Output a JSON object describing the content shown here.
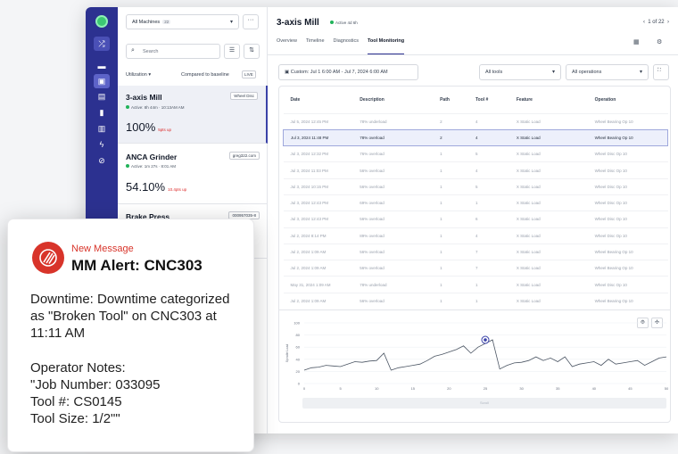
{
  "sidebar": {
    "icons": [
      "shuffle-icon",
      "folder-icon",
      "machine-icon",
      "calendar-icon",
      "document-icon",
      "chart-icon",
      "lightning-icon",
      "link-icon"
    ]
  },
  "list": {
    "machine_select": "All Machines",
    "machine_count": "22",
    "search_placeholder": "Search",
    "utilization_label": "Utilization ▾",
    "baseline_label": "Compared to baseline",
    "live_label": "LIVE",
    "machines": [
      {
        "name": "3-axis Mill",
        "tag": "Wheel Disc",
        "status": "Active: 8h 44m",
        "since": "10:13AM AM",
        "value": "100%",
        "delta": "5pts up"
      },
      {
        "name": "ANCA Grinder",
        "tag": "greg322.com",
        "status": "Active: 1m 27s",
        "since": "8:01 AM",
        "value": "54.10%",
        "delta": "10.4pts up"
      },
      {
        "name": "Brake Press",
        "tag": "000957035-8",
        "status": "",
        "since": "",
        "value": "",
        "delta": ""
      }
    ]
  },
  "detail": {
    "title": "3-axis Mill",
    "status": "Active 4d 6h",
    "pager": "1 of 22",
    "tabs": [
      "Overview",
      "Timeline",
      "Diagnostics",
      "Tool Monitoring"
    ],
    "active_tab": "Tool Monitoring",
    "date_range": "Custom:  Jul 1 6:00 AM - Jul 7, 2024 6:00 AM",
    "tools_filter": "All tools",
    "ops_filter": "All operations",
    "table": {
      "headers": [
        "Date",
        "Description",
        "Path",
        "Tool #",
        "Feature",
        "Operation"
      ],
      "rows": [
        [
          "Jul 5, 2024 12:45 PM",
          "78% underload",
          "2",
          "4",
          "X Static Load",
          "Wheel Bearing Op 10"
        ],
        [
          "Jul 3, 2024 11:48 PM",
          "78% overload",
          "2",
          "4",
          "X Static Load",
          "Wheel Bearing Op 10"
        ],
        [
          "Jul 3, 2024 12:32 PM",
          "76% overload",
          "1",
          "5",
          "X Static Load",
          "Wheel Disc Op 10"
        ],
        [
          "Jul 3, 2024 11:03 PM",
          "56% overload",
          "1",
          "4",
          "X Static Load",
          "Wheel Disc Op 10"
        ],
        [
          "Jul 3, 2024 10:15 PM",
          "56% overload",
          "1",
          "5",
          "X Static Load",
          "Wheel Disc Op 10"
        ],
        [
          "Jul 3, 2024 12:43 PM",
          "69% overload",
          "1",
          "1",
          "X Static Load",
          "Wheel Disc Op 10"
        ],
        [
          "Jul 3, 2024 12:43 PM",
          "56% overload",
          "1",
          "6",
          "X Static Load",
          "Wheel Disc Op 10"
        ],
        [
          "Jul 2, 2024 8:14 PM",
          "89% overload",
          "1",
          "4",
          "X Static Load",
          "Wheel Disc Op 10"
        ],
        [
          "Jul 2, 2024 1:09 AM",
          "56% overload",
          "1",
          "7",
          "X Static Load",
          "Wheel Bearing Op 10"
        ],
        [
          "Jul 2, 2024 1:09 AM",
          "56% overload",
          "1",
          "7",
          "X Static Load",
          "Wheel Bearing Op 10"
        ],
        [
          "May 31, 2024 1:09 AM",
          "78% underload",
          "1",
          "1",
          "X Static Load",
          "Wheel Disc Op 10"
        ],
        [
          "Jul 2, 2024 1:09 AM",
          "56% overload",
          "1",
          "1",
          "X Static Load",
          "Wheel Bearing Op 10"
        ]
      ],
      "selected_row": 1
    },
    "scroll_label": "Scroll"
  },
  "chart_data": {
    "type": "line",
    "title": "",
    "xlabel": "",
    "ylabel": "Spindle Load",
    "x_ticks": [
      "0",
      "5",
      "10",
      "15",
      "20",
      "25",
      "30",
      "35",
      "40",
      "45",
      "50"
    ],
    "y_ticks": [
      "0",
      "20",
      "40",
      "60",
      "80",
      "100"
    ],
    "xlim": [
      0,
      50
    ],
    "ylim": [
      0,
      100
    ],
    "series": [
      {
        "x": [
          0,
          1,
          2,
          3,
          4,
          5,
          6,
          7,
          8,
          9,
          10,
          11,
          12,
          13,
          14,
          15,
          16,
          17,
          18,
          19,
          20,
          21,
          22,
          23,
          24,
          25,
          26,
          27,
          28,
          29,
          30,
          31,
          32,
          33,
          34,
          35,
          36,
          37,
          38,
          39,
          40,
          41,
          42,
          43,
          44,
          45,
          46,
          47,
          48,
          49,
          50
        ],
        "values": [
          22,
          26,
          27,
          30,
          29,
          28,
          32,
          36,
          35,
          37,
          38,
          50,
          22,
          26,
          28,
          30,
          32,
          38,
          45,
          48,
          52,
          56,
          62,
          50,
          60,
          66,
          72,
          24,
          30,
          34,
          35,
          38,
          44,
          38,
          42,
          36,
          44,
          28,
          32,
          34,
          36,
          30,
          40,
          32,
          34,
          36,
          38,
          30,
          36,
          42,
          44
        ]
      }
    ],
    "marker": {
      "x": 25,
      "value": 72
    },
    "grid": true
  },
  "notification": {
    "kicker": "New Message",
    "title": "MM Alert: CNC303",
    "body": "Downtime: Downtime categorized as \"Broken Tool\" on CNC303 at 11:11 AM",
    "notes": [
      "Operator Notes:",
      "\"Job Number: 033095",
      "Tool #: CS0145",
      "Tool Size: 1/2\"\""
    ]
  }
}
